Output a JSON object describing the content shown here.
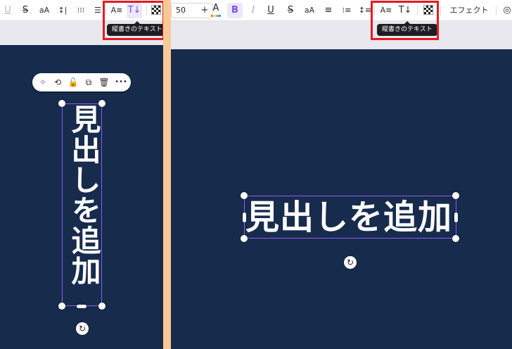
{
  "left_panel": {
    "toolbar": {
      "underline": "U",
      "strikethrough": "S",
      "letter_case": "aA",
      "letter_spacing": "↕|",
      "list": "⁝⁝⁝",
      "align": "☰",
      "text_style": "A≋",
      "vertical_text": "T↓"
    },
    "tooltip": "縦書きのテキスト",
    "text": "見出しを追加",
    "context_toolbar": [
      "✧",
      "⟲",
      "🔓",
      "⧉",
      "🗑",
      "•••"
    ],
    "rotate_icon": "↻"
  },
  "right_panel": {
    "toolbar": {
      "font_size": "50",
      "font_size_plus": "+",
      "text_color": "A",
      "bold": "B",
      "italic": "I",
      "underline": "U",
      "strikethrough": "S",
      "letter_case": "aA",
      "align": "≡",
      "list": "⁝≡",
      "spacing": "↕≡",
      "text_style": "A≋",
      "vertical_text": "T↓",
      "effects": "エフェクト",
      "animate": "◎"
    },
    "tooltip": "縦書きのテキスト",
    "text": "見出しを追加",
    "rotate_icon": "↻"
  },
  "colors": {
    "canvas_bg": "#172b4d",
    "selection": "#8b5cf6",
    "highlight": "#e31b23",
    "accent_purple": "#7a4ddf"
  }
}
